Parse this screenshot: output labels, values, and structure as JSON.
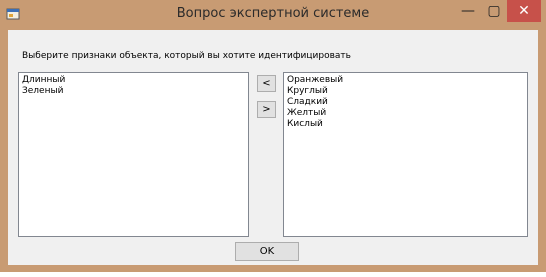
{
  "window": {
    "title": "Вопрос экспертной системе",
    "minimize_label": "—",
    "maximize_label": "▢",
    "close_label": "✕"
  },
  "prompt": "Выберите  признаки объекта, который вы хотите идентифицировать",
  "left_list": {
    "items": [
      "Длинный",
      "Зеленый"
    ]
  },
  "right_list": {
    "items": [
      "Оранжевый",
      "Круглый",
      "Сладкий",
      "Желтый",
      "Кислый"
    ]
  },
  "buttons": {
    "move_left_label": "<",
    "move_right_label": ">",
    "ok_label": "OK"
  },
  "colors": {
    "frame": "#c89b73",
    "client": "#f0f0f0",
    "close": "#c7514a"
  }
}
